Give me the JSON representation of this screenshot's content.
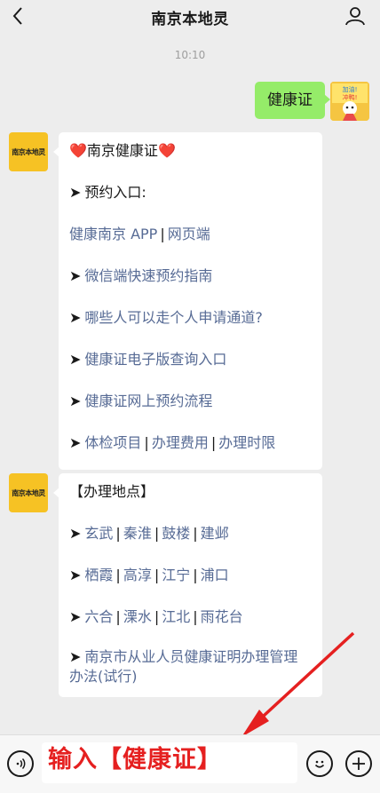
{
  "header": {
    "title": "南京本地灵",
    "back_icon": "chevron-left-icon",
    "profile_icon": "person-icon"
  },
  "timestamp": "10:10",
  "user_message": "健康证",
  "user_avatar": {
    "text_line1": "加油!",
    "text_line2": "冲鸭!"
  },
  "bot": {
    "avatar_text": "南京本地灵"
  },
  "card1": {
    "title": "南京健康证",
    "heart": "❤️",
    "arrow": "➤",
    "appointment_label": "预约入口:",
    "app_link": "健康南京 APP",
    "web_link": "网页端",
    "wechat_link": "微信端快速预约指南",
    "individual_link": "哪些人可以走个人申请通道?",
    "query_link": "健康证电子版查询入口",
    "process_link": "健康证网上预约流程",
    "items_link": "体检项目",
    "fee_link": "办理费用",
    "time_link": "办理时限",
    "separator": "|"
  },
  "card2": {
    "title": "【办理地点】",
    "row1": [
      "玄武",
      "秦淮",
      "鼓楼",
      "建邺"
    ],
    "row2": [
      "栖霞",
      "高淳",
      "江宁",
      "浦口"
    ],
    "row3": [
      "六合",
      "溧水",
      "江北",
      "雨花台"
    ],
    "regulation_link": "南京市从业人员健康证明办理管理办法(试行)"
  },
  "input": {
    "value": "输入【健康证】",
    "voice_icon": "voice-icon",
    "emoji_icon": "emoji-icon",
    "plus_icon": "plus-icon"
  },
  "colors": {
    "background": "#ededed",
    "bubble_green": "#95ec69",
    "link": "#576b95",
    "annotation_red": "#e52020",
    "avatar_yellow": "#f6c224"
  }
}
